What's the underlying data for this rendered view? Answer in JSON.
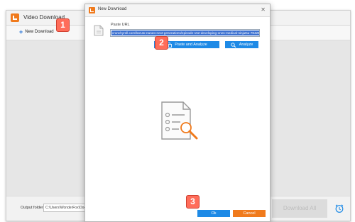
{
  "main_window": {
    "title": "Video Download",
    "new_download_label": "New Download",
    "output_folder_label": "Output folder:",
    "output_folder_value": "C:\\Users\\WonderFox\\Docume",
    "download_all_label": "Download All"
  },
  "dialog": {
    "title": "New Download",
    "paste_url_label": "Paste URL",
    "url_value": "crunchyroll.com/boruto-naruto-next-generations/episode-152-developing-ones-medical-ninjutsu-784252",
    "paste_analyze_label": "Paste and Analyze",
    "analyze_label": "Analyze",
    "ok_label": "Ok",
    "cancel_label": "Cancel"
  },
  "callouts": [
    "1",
    "2",
    "3"
  ],
  "colors": {
    "accent_blue": "#1e8ae6",
    "accent_orange": "#f07a1c",
    "badge_red": "#ff6d5a"
  }
}
